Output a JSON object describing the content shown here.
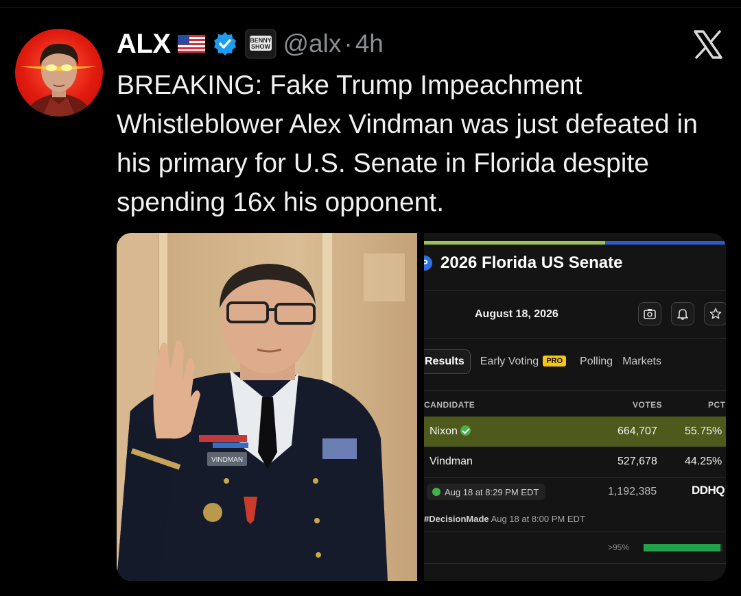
{
  "tweet": {
    "name": "ALX",
    "handle": "@alx",
    "separator": "·",
    "time": "4h",
    "affiliate_badge": "BENNY SHOW",
    "text": "BREAKING: Fake Trump Impeachment Whistleblower Alex Vindman was just defeated in his primary for U.S. Senate in Florida despite spending 16x his opponent."
  },
  "colors": {
    "verified": "#1d9bf0",
    "winner_row": "#4d5a1c",
    "check": "#4caf50"
  },
  "media": {
    "photo_nameplate": "VINDMAN",
    "screenshot": {
      "logo_letter": "P",
      "title": "2026 Florida US Senate",
      "date": "August 18, 2026",
      "icons": [
        "camera-icon",
        "bell-icon",
        "star-icon"
      ],
      "progress": 0.6,
      "tabs": {
        "results": "Results",
        "early_voting": "Early Voting",
        "pro_badge": "PRO",
        "polling": "Polling",
        "markets": "Markets"
      },
      "columns": {
        "candidate": "CANDIDATE",
        "votes": "VOTES",
        "pct": "PCT"
      },
      "rows": [
        {
          "candidate": "Nixon",
          "votes": "664,707",
          "pct": "55.75%",
          "winner": true
        },
        {
          "candidate": "Vindman",
          "votes": "527,678",
          "pct": "44.25%",
          "winner": false
        }
      ],
      "updated": "Aug 18 at 8:29 PM EDT",
      "total_votes": "1,192,385",
      "source": "DDHQ",
      "decision_tag": "#DecisionMade",
      "decision_time": "Aug 18 at 8:00 PM EDT",
      "reporting_label": ">95%",
      "reporting_fraction": 0.97
    }
  }
}
